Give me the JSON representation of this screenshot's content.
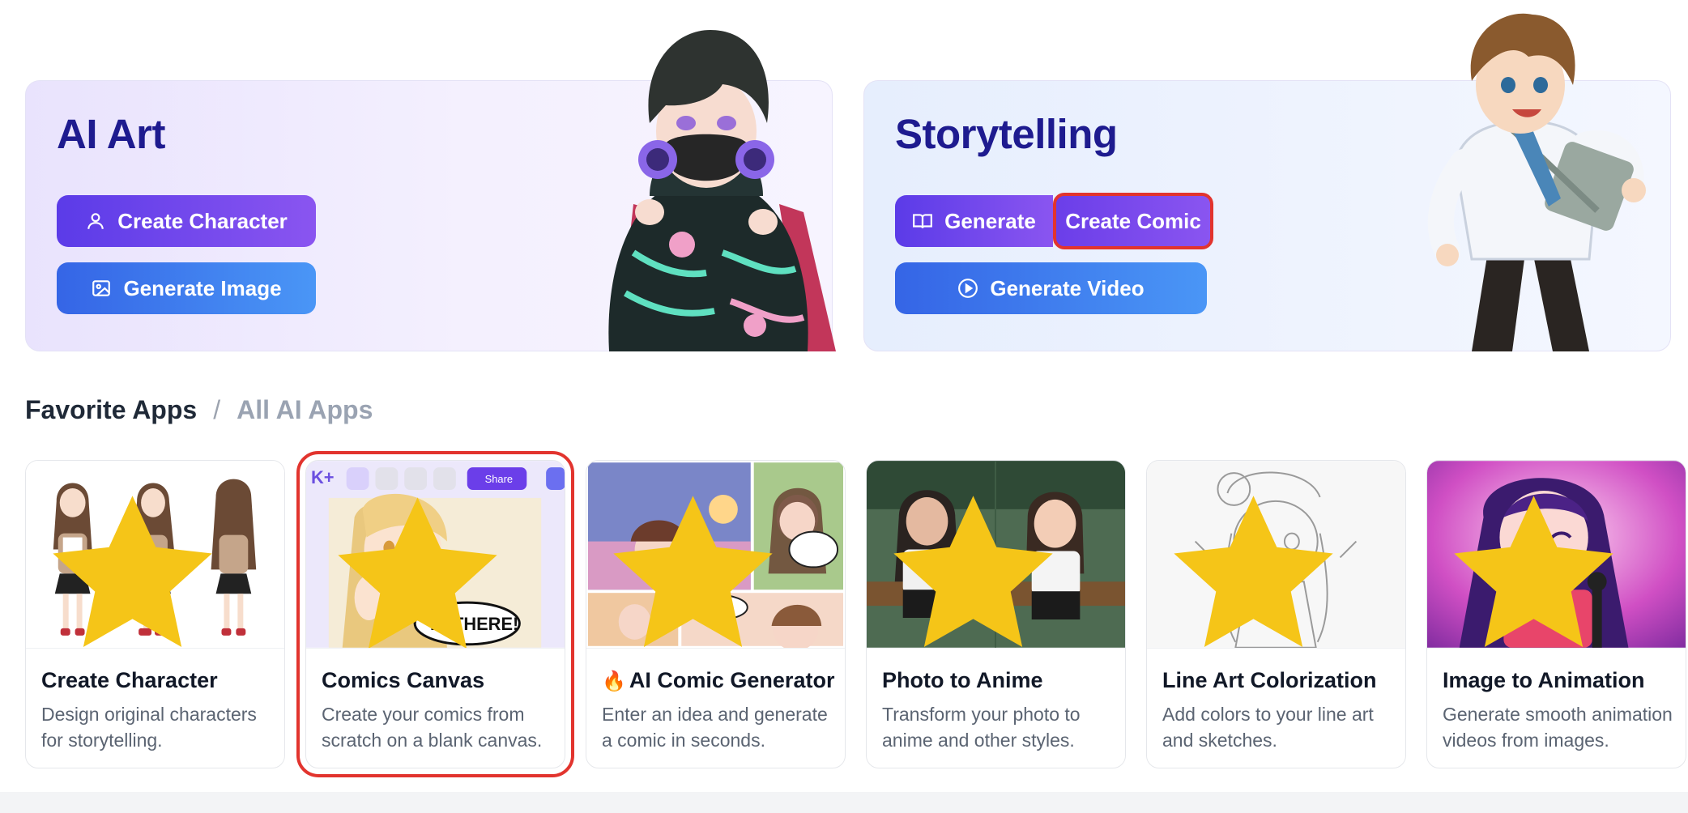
{
  "hero_art": {
    "title": "AI Art",
    "buttons": {
      "create_character": "Create Character",
      "generate_image": "Generate Image"
    }
  },
  "hero_story": {
    "title": "Storytelling",
    "buttons": {
      "generate": "Generate",
      "create_comic": "Create Comic",
      "generate_video": "Generate Video"
    }
  },
  "section": {
    "favorite": "Favorite Apps",
    "separator": "/",
    "all": "All AI Apps"
  },
  "apps": [
    {
      "title": "Create Character",
      "desc": "Design original characters for storytelling.",
      "starred": true
    },
    {
      "title": "Comics Canvas",
      "desc": "Create your comics from scratch on a blank canvas.",
      "starred": true,
      "highlighted": true,
      "toolbar_share": "Share",
      "speech": "HI THERE!"
    },
    {
      "title": "AI Comic Generator",
      "prefix_icon": "fire-icon",
      "desc": "Enter an idea and generate a comic in seconds.",
      "starred": true
    },
    {
      "title": "Photo to Anime",
      "desc": "Transform your photo to anime and other styles.",
      "starred": true
    },
    {
      "title": "Line Art Colorization",
      "desc": "Add colors to your line art and sketches.",
      "starred": true
    },
    {
      "title": "Image to Animation",
      "desc": "Generate smooth animation videos from images.",
      "starred": true
    }
  ],
  "colors": {
    "title_navy": "#1e1b8f",
    "violet": "#6b3ee9",
    "blue": "#3b7bf0",
    "highlight_red": "#e2342e",
    "star_yellow": "#f5c518"
  }
}
